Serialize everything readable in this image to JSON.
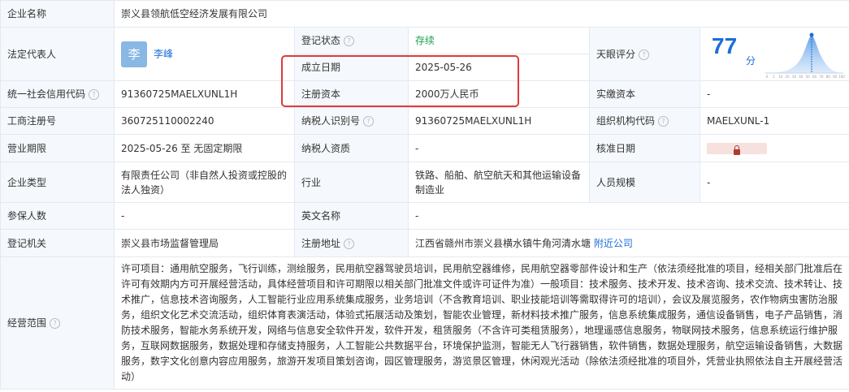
{
  "company_name": {
    "label": "企业名称",
    "value": "崇义县领航低空经济发展有限公司"
  },
  "legal_rep": {
    "label": "法定代表人",
    "avatar_char": "李",
    "name": "李峰"
  },
  "reg_status": {
    "label": "登记状态",
    "value": "存续"
  },
  "tianyan_score": {
    "label": "天眼评分",
    "value": "77",
    "unit": "分",
    "axis": [
      "0",
      "1",
      "10",
      "20",
      "30",
      "40",
      "50",
      "60",
      "70",
      "80",
      "90",
      "100"
    ]
  },
  "established": {
    "label": "成立日期",
    "value": "2025-05-26"
  },
  "credit_code": {
    "label": "统一社会信用代码",
    "value": "91360725MAELXUNL1H"
  },
  "reg_capital": {
    "label": "注册资本",
    "value": "2000万人民币"
  },
  "paid_capital": {
    "label": "实缴资本",
    "value": "-"
  },
  "biz_reg_no": {
    "label": "工商注册号",
    "value": "360725110002240"
  },
  "taxpayer_id": {
    "label": "纳税人识别号",
    "value": "91360725MAELXUNL1H"
  },
  "org_code": {
    "label": "组织机构代码",
    "value": "MAELXUNL-1"
  },
  "biz_term": {
    "label": "营业期限",
    "value": "2025-05-26 至 无固定期限"
  },
  "taxpayer_qual": {
    "label": "纳税人资质",
    "value": "-"
  },
  "approval_date": {
    "label": "核准日期"
  },
  "company_type": {
    "label": "企业类型",
    "value": "有限责任公司（非自然人投资或控股的法人独资）"
  },
  "industry": {
    "label": "行业",
    "value": "铁路、船舶、航空航天和其他运输设备制造业"
  },
  "staff_size": {
    "label": "人员规模",
    "value": "-"
  },
  "insured": {
    "label": "参保人数",
    "value": "-"
  },
  "english_name": {
    "label": "英文名称",
    "value": "-"
  },
  "reg_authority": {
    "label": "登记机关",
    "value": "崇义县市场监督管理局"
  },
  "reg_address": {
    "label": "注册地址",
    "value": "江西省赣州市崇义县横水镇牛角河清水塘",
    "nearby_link": "附近公司"
  },
  "biz_scope": {
    "label": "经营范围",
    "value": "许可项目：通用航空服务，飞行训练，测绘服务，民用航空器驾驶员培训，民用航空器维修，民用航空器零部件设计和生产（依法须经批准的项目，经相关部门批准后在许可有效期内方可开展经营活动，具体经营项目和许可期限以相关部门批准文件或许可证件为准）一般项目：技术服务、技术开发、技术咨询、技术交流、技术转让、技术推广，信息技术咨询服务，人工智能行业应用系统集成服务，业务培训（不含教育培训、职业技能培训等需取得许可的培训），会议及展览服务，农作物病虫害防治服务，组织文化艺术交流活动，组织体育表演活动，体验式拓展活动及策划，智能农业管理，新材料技术推广服务，信息系统集成服务，通信设备销售，电子产品销售，消防技术服务，智能水务系统开发，网络与信息安全软件开发，软件开发，租赁服务（不含许可类租赁服务），地理遥感信息服务，物联网技术服务，信息系统运行维护服务，互联网数据服务，数据处理和存储支持服务，人工智能公共数据平台，环境保护监测，智能无人飞行器销售，软件销售，数据处理服务，航空运输设备销售，大数据服务，数字文化创意内容应用服务，旅游开发项目策划咨询，园区管理服务，游览景区管理，休闲观光活动（除依法须经批准的项目外，凭营业执照依法自主开展经营活动）"
  },
  "colors": {
    "accent": "#1a6ed8",
    "status_green": "#1aa04e",
    "label_bg": "#f5f8fc",
    "highlight_red": "#e03a3a"
  }
}
